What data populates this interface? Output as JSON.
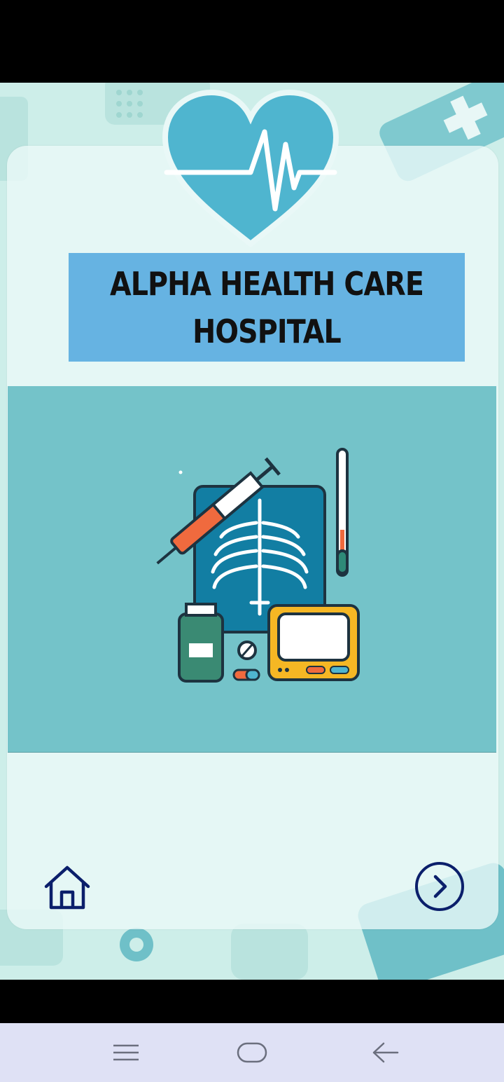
{
  "hospital": {
    "title": "ALPHA HEALTH CARE HOSPITAL"
  },
  "navigation": {
    "home_icon": "home-icon",
    "next_icon": "chevron-right-circle-icon"
  },
  "system_nav": {
    "menu_icon": "menu-icon",
    "home_icon": "home-pill-icon",
    "back_icon": "back-arrow-icon"
  },
  "colors": {
    "background": "#cdeee9",
    "title_box": "#66b3e2",
    "illustration_panel": "#74c3c9",
    "heart": "#4fb5cf",
    "nav_icon": "#0b1f6b",
    "system_nav_bg": "#dfe1f5"
  }
}
